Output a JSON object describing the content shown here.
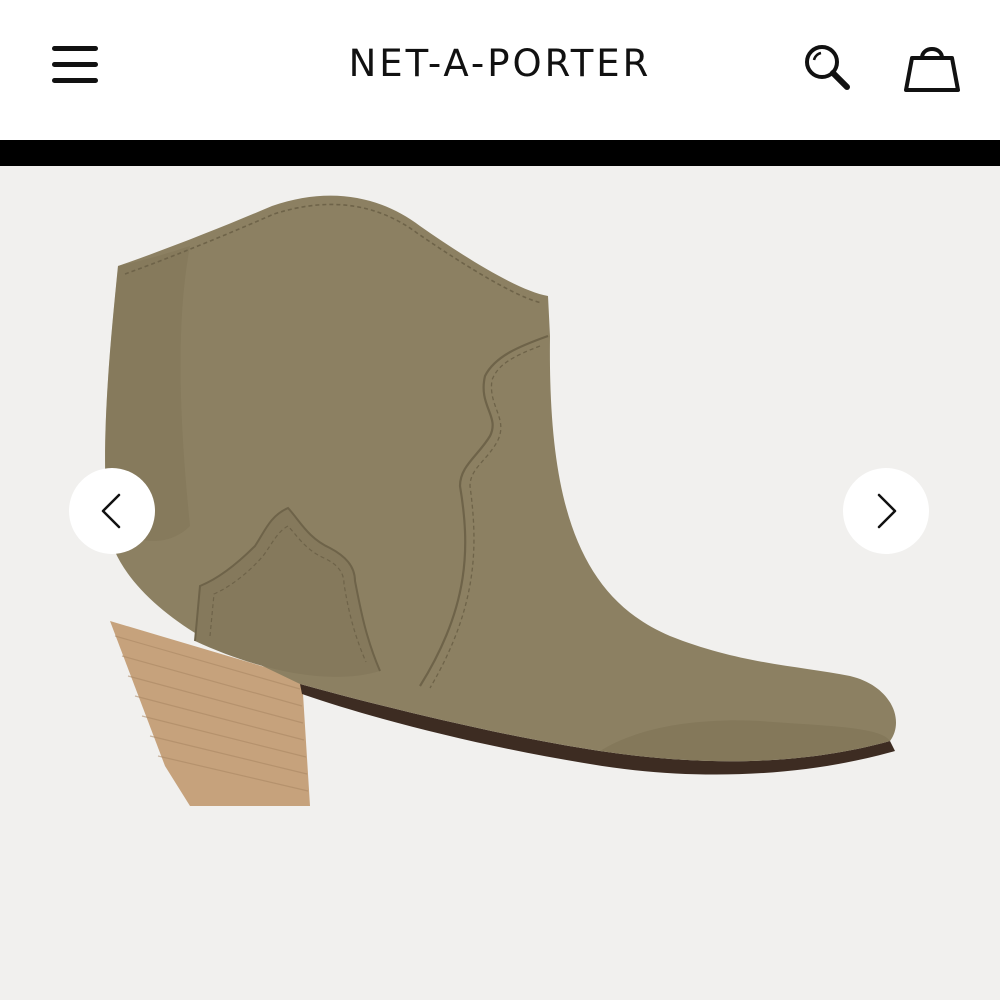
{
  "header": {
    "brand": "NET-A-PORTER",
    "menu_icon": "hamburger-menu-icon",
    "search_icon": "search-icon",
    "bag_icon": "shopping-bag-icon"
  },
  "gallery": {
    "product_image": "suede-western-ankle-boot",
    "prev_icon": "chevron-left-icon",
    "next_icon": "chevron-right-icon"
  },
  "colors": {
    "header_bg": "#ffffff",
    "divider": "#000000",
    "gallery_bg": "#f1f0ee",
    "suede": "#8c8062",
    "heel_wood": "#c6a27c",
    "sole": "#3d2c22"
  }
}
